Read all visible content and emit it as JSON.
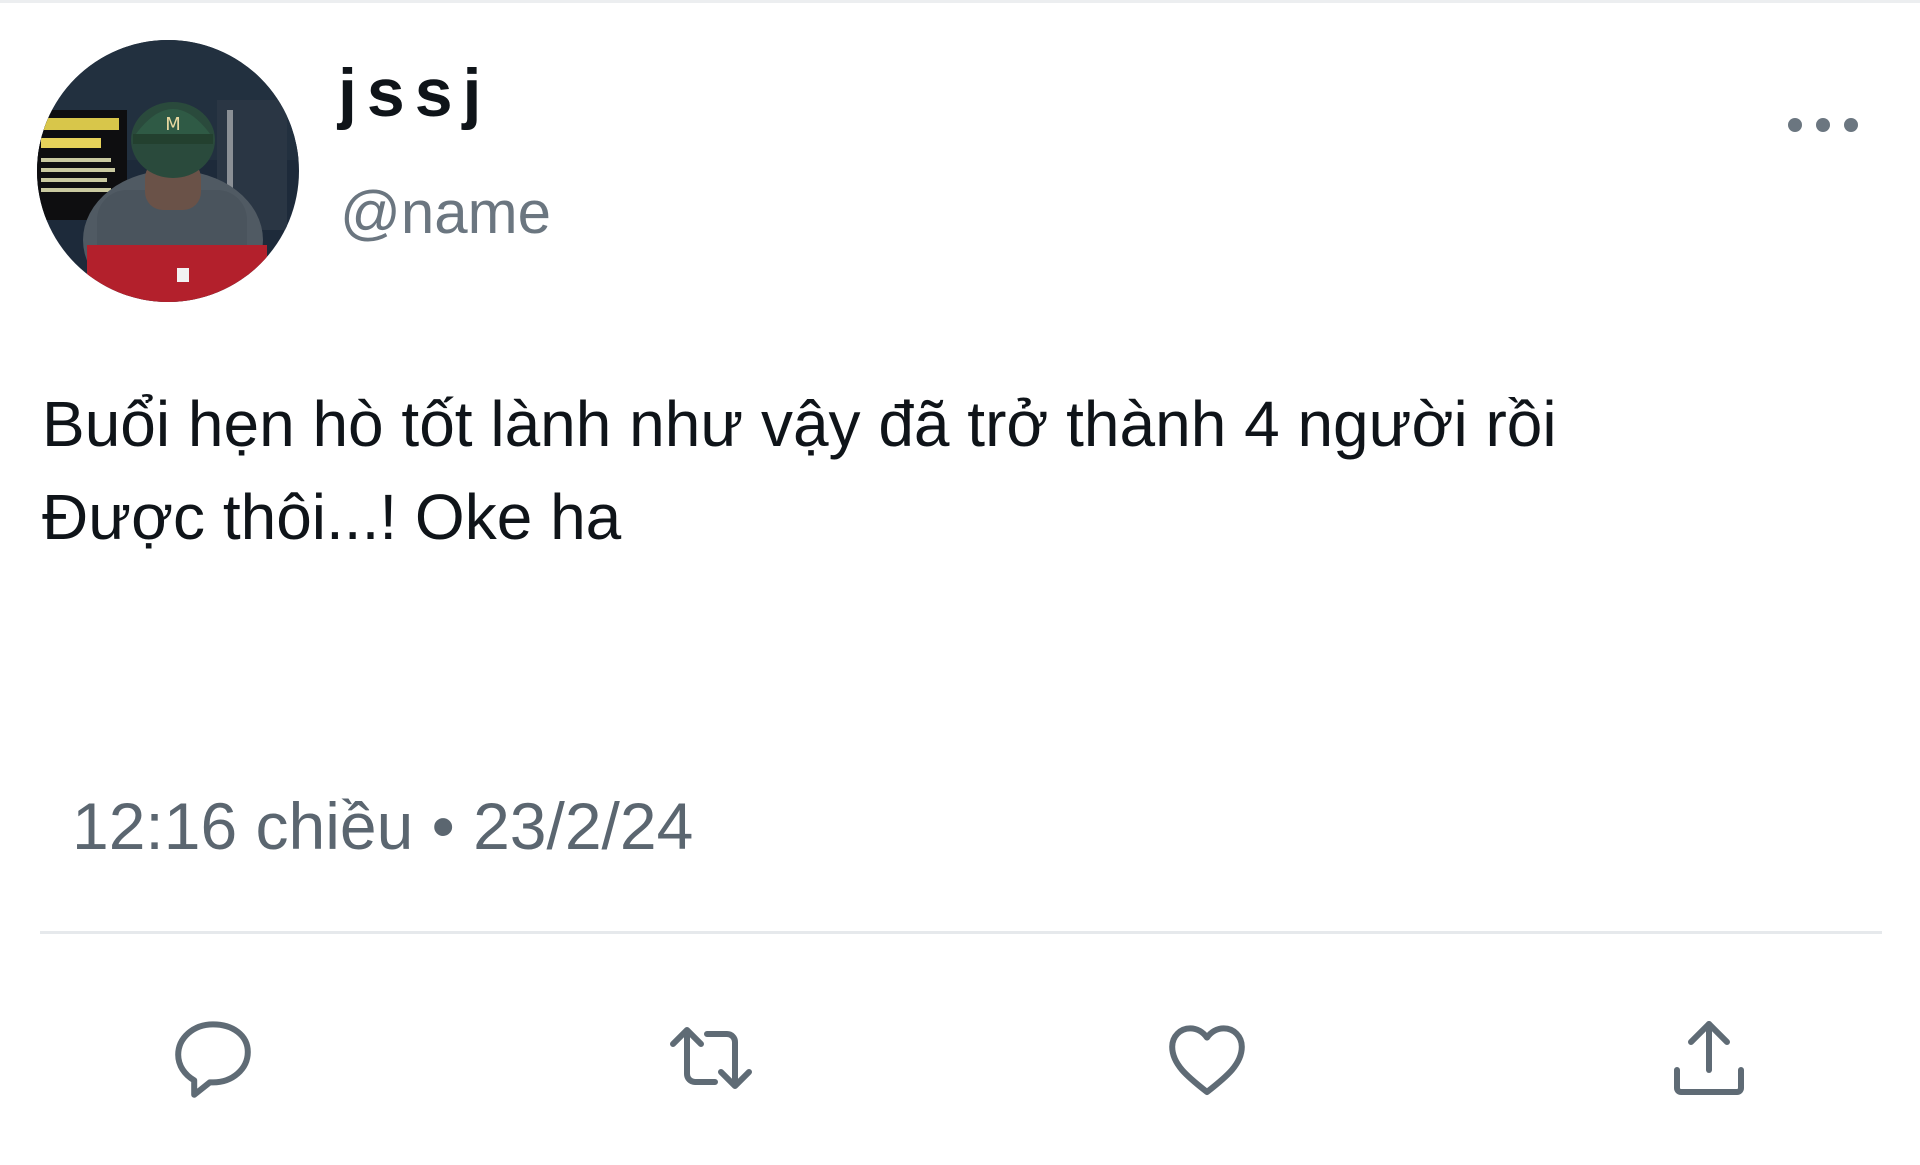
{
  "author": {
    "display_name": "jssj",
    "handle": "@name"
  },
  "tweet": {
    "lines": [
      "Buổi hẹn hò tốt lành như vậy đã trở thành 4 người rồi",
      "Được thôi...! Oke ha"
    ]
  },
  "meta": {
    "time": "12:16 chiều",
    "separator": "•",
    "date": "23/2/24"
  },
  "actions": [
    {
      "icon": "reply-icon"
    },
    {
      "icon": "retweet-icon"
    },
    {
      "icon": "like-icon"
    },
    {
      "icon": "share-icon"
    }
  ],
  "colors": {
    "text": "#0f1419",
    "secondary": "#6b7680",
    "icon": "#5f6b75",
    "divider": "#e6e9ec"
  }
}
